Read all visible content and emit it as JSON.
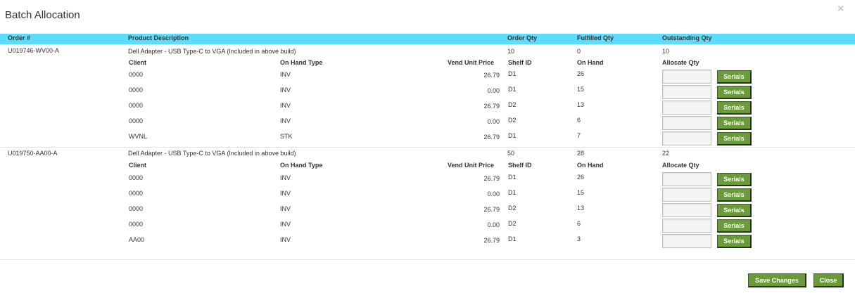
{
  "modal": {
    "title": "Batch Allocation",
    "close_glyph": "×"
  },
  "header": {
    "order": "Order #",
    "product": "Product Description",
    "order_qty": "Order Qty",
    "fulfilled_qty": "Fulfilled Qty",
    "outstanding_qty": "Outstanding Qty"
  },
  "sub_header": {
    "client": "Client",
    "on_hand_type": "On Hand Type",
    "vend_unit_price": "Vend Unit Price",
    "shelf_id": "Shelf ID",
    "on_hand": "On Hand",
    "allocate_qty": "Allocate Qty"
  },
  "orders": [
    {
      "order": "U019746-WV00-A",
      "product": "Dell Adapter - USB Type-C to VGA (Included in above build)",
      "order_qty": "10",
      "fulfilled_qty": "0",
      "outstanding_qty": "10",
      "rows": [
        {
          "client": "0000",
          "type": "INV",
          "price": "26.79",
          "shelf": "D1",
          "on_hand": "26",
          "allocate": ""
        },
        {
          "client": "0000",
          "type": "INV",
          "price": "0.00",
          "shelf": "D1",
          "on_hand": "15",
          "allocate": ""
        },
        {
          "client": "0000",
          "type": "INV",
          "price": "26.79",
          "shelf": "D2",
          "on_hand": "13",
          "allocate": ""
        },
        {
          "client": "0000",
          "type": "INV",
          "price": "0.00",
          "shelf": "D2",
          "on_hand": "6",
          "allocate": ""
        },
        {
          "client": "WVNL",
          "type": "STK",
          "price": "26.79",
          "shelf": "D1",
          "on_hand": "7",
          "allocate": ""
        }
      ]
    },
    {
      "order": "U019750-AA00-A",
      "product": "Dell Adapter - USB Type-C to VGA (Included in above build)",
      "order_qty": "50",
      "fulfilled_qty": "28",
      "outstanding_qty": "22",
      "rows": [
        {
          "client": "0000",
          "type": "INV",
          "price": "26.79",
          "shelf": "D1",
          "on_hand": "26",
          "allocate": ""
        },
        {
          "client": "0000",
          "type": "INV",
          "price": "0.00",
          "shelf": "D1",
          "on_hand": "15",
          "allocate": ""
        },
        {
          "client": "0000",
          "type": "INV",
          "price": "26.79",
          "shelf": "D2",
          "on_hand": "13",
          "allocate": ""
        },
        {
          "client": "0000",
          "type": "INV",
          "price": "0.00",
          "shelf": "D2",
          "on_hand": "6",
          "allocate": ""
        },
        {
          "client": "AA00",
          "type": "INV",
          "price": "26.79",
          "shelf": "D1",
          "on_hand": "3",
          "allocate": ""
        }
      ]
    }
  ],
  "buttons": {
    "serials": "Serials",
    "save": "Save Changes",
    "close": "Close"
  },
  "colors": {
    "header_bar": "#5bdcfb",
    "button_green": "#6a9a3a"
  }
}
